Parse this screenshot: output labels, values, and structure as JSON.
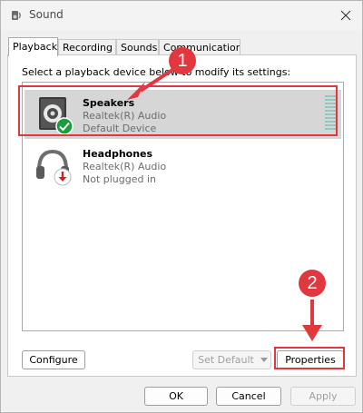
{
  "window": {
    "title": "Sound"
  },
  "tabs": [
    {
      "label": "Playback"
    },
    {
      "label": "Recording"
    },
    {
      "label": "Sounds"
    },
    {
      "label": "Communications"
    }
  ],
  "panel": {
    "instruction": "Select a playback device below to modify its settings:"
  },
  "devices": [
    {
      "name": "Speakers",
      "driver": "Realtek(R) Audio",
      "status": "Default Device",
      "icon": "speaker-icon",
      "status_icon": "green-check-icon"
    },
    {
      "name": "Headphones",
      "driver": "Realtek(R) Audio",
      "status": "Not plugged in",
      "icon": "headphones-icon",
      "status_icon": "red-down-arrow-icon"
    }
  ],
  "buttons": {
    "configure": "Configure",
    "set_default": "Set Default",
    "properties": "Properties",
    "ok": "OK",
    "cancel": "Cancel",
    "apply": "Apply"
  },
  "annotations": {
    "step1": "1",
    "step2": "2",
    "color": "#e0383e"
  }
}
